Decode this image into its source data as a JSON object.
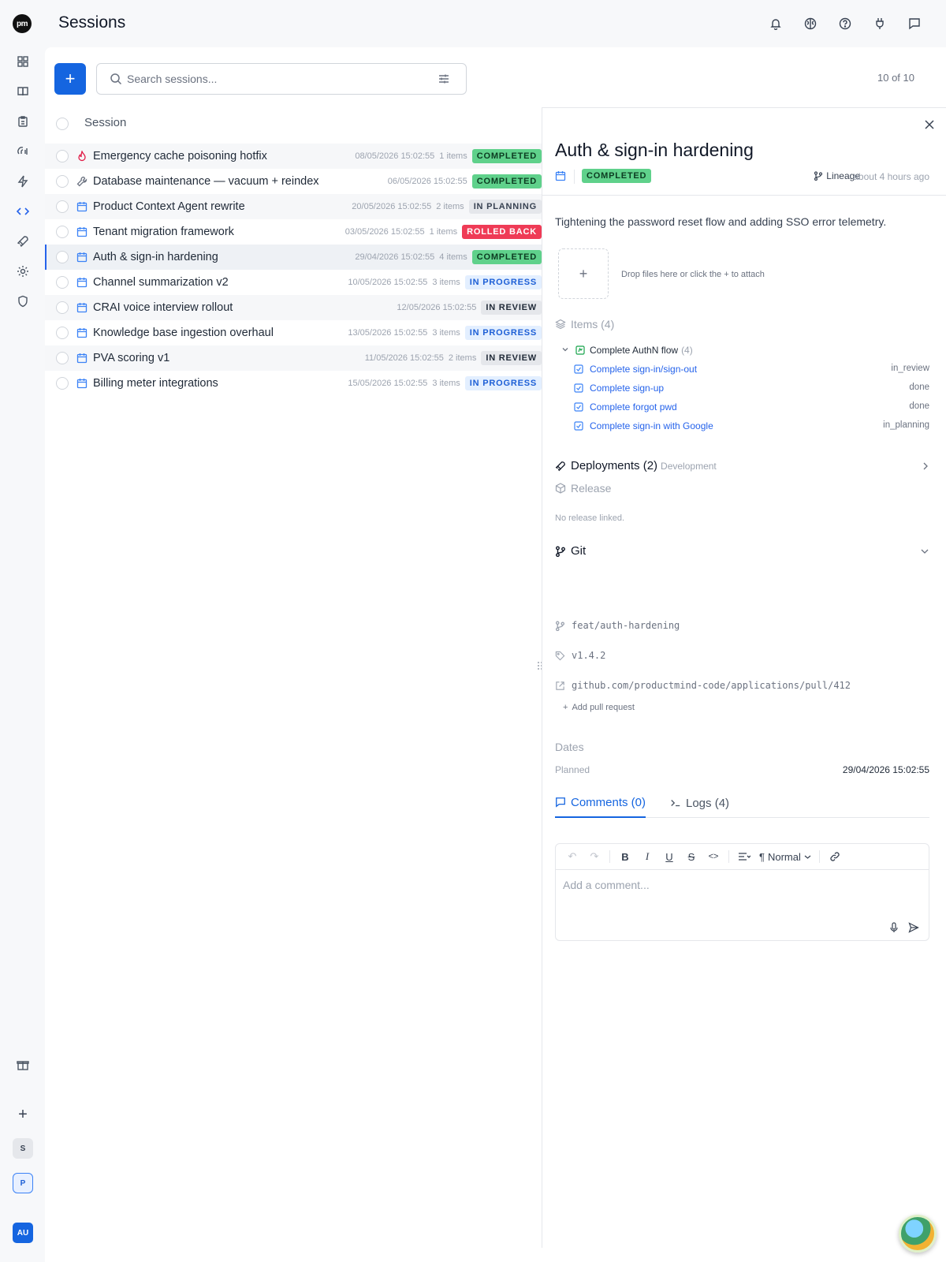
{
  "app": {
    "logo_text": "pm",
    "page_title": "Sessions"
  },
  "sidebar": {
    "items": [
      {
        "icon": "dashboard-icon"
      },
      {
        "icon": "book-icon"
      },
      {
        "icon": "clipboard-icon"
      },
      {
        "icon": "voice-icon"
      },
      {
        "icon": "lightning-icon"
      },
      {
        "icon": "code-icon",
        "active": true
      },
      {
        "icon": "rocket-icon"
      },
      {
        "icon": "settings-icon"
      },
      {
        "icon": "shield-icon"
      }
    ],
    "bottom": {
      "gift": "gift-icon",
      "add": "+",
      "workspace_s": "S",
      "workspace_p": "P",
      "user": "AU"
    }
  },
  "header_icons": [
    "bell-icon",
    "brain-icon",
    "help-icon",
    "plug-icon",
    "chat-icon"
  ],
  "toolbar": {
    "add_label": "+",
    "search_placeholder": "Search sessions...",
    "count": "10 of 10"
  },
  "list": {
    "column_label": "Session",
    "rows": [
      {
        "name": "Emergency cache poisoning hotfix",
        "icon": "flame-icon",
        "date": "08/05/2026 15:02:55",
        "items": "1 items",
        "status": "COMPLETED",
        "kind": "completed"
      },
      {
        "name": "Database maintenance — vacuum + reindex",
        "icon": "wrench-icon",
        "date": "06/05/2026 15:02:55",
        "items": "",
        "status": "COMPLETED",
        "kind": "completed"
      },
      {
        "name": "Product Context Agent rewrite",
        "icon": "calendar-icon",
        "date": "20/05/2026 15:02:55",
        "items": "2 items",
        "status": "IN PLANNING",
        "kind": "planning"
      },
      {
        "name": "Tenant migration framework",
        "icon": "calendar-icon",
        "date": "03/05/2026 15:02:55",
        "items": "1 items",
        "status": "ROLLED BACK",
        "kind": "rolled"
      },
      {
        "name": "Auth & sign-in hardening",
        "icon": "calendar-icon",
        "date": "29/04/2026 15:02:55",
        "items": "4 items",
        "status": "COMPLETED",
        "kind": "completed",
        "selected": true
      },
      {
        "name": "Channel summarization v2",
        "icon": "calendar-icon",
        "date": "10/05/2026 15:02:55",
        "items": "3 items",
        "status": "IN PROGRESS",
        "kind": "progress"
      },
      {
        "name": "CRAI voice interview rollout",
        "icon": "calendar-icon",
        "date": "12/05/2026 15:02:55",
        "items": "",
        "status": "IN REVIEW",
        "kind": "review"
      },
      {
        "name": "Knowledge base ingestion overhaul",
        "icon": "calendar-icon",
        "date": "13/05/2026 15:02:55",
        "items": "3 items",
        "status": "IN PROGRESS",
        "kind": "progress"
      },
      {
        "name": "PVA scoring v1",
        "icon": "calendar-icon",
        "date": "11/05/2026 15:02:55",
        "items": "2 items",
        "status": "IN REVIEW",
        "kind": "review"
      },
      {
        "name": "Billing meter integrations",
        "icon": "calendar-icon",
        "date": "15/05/2026 15:02:55",
        "items": "3 items",
        "status": "IN PROGRESS",
        "kind": "progress"
      }
    ]
  },
  "detail": {
    "title": "Auth & sign-in hardening",
    "status": "COMPLETED",
    "lineage_label": "Lineage",
    "updated": "about 4 hours ago",
    "description": "Tightening the password reset flow and adding SSO error telemetry.",
    "attach_hint": "Drop files here or click the + to attach",
    "items_label": "Items (4)",
    "parent_item": {
      "label": "Complete AuthN flow",
      "count": "(4)"
    },
    "children": [
      {
        "label": "Complete sign-in/sign-out",
        "status": "in_review"
      },
      {
        "label": "Complete sign-up",
        "status": "done"
      },
      {
        "label": "Complete forgot pwd",
        "status": "done"
      },
      {
        "label": "Complete sign-in with Google",
        "status": "in_planning"
      }
    ],
    "deployments_label": "Deployments (2)",
    "deployments_env": "Development",
    "release_label": "Release",
    "release_note": "No release linked.",
    "git_label": "Git",
    "git_branch": "feat/auth-hardening",
    "git_tag": "v1.4.2",
    "git_pr": "github.com/productmind-code/applications/pull/412",
    "add_pr_label": "Add pull request",
    "dates_label": "Dates",
    "planned_label": "Planned",
    "planned_value": "29/04/2026 15:02:55",
    "tabs": {
      "comments": "Comments (0)",
      "logs": "Logs (4)"
    },
    "editor": {
      "format": "Normal",
      "placeholder": "Add a comment..."
    }
  },
  "colors": {
    "accent": "#1565e0",
    "completed": "#5fd18b",
    "rolled_back": "#ef3b56",
    "in_progress_bg": "#e3efff"
  }
}
